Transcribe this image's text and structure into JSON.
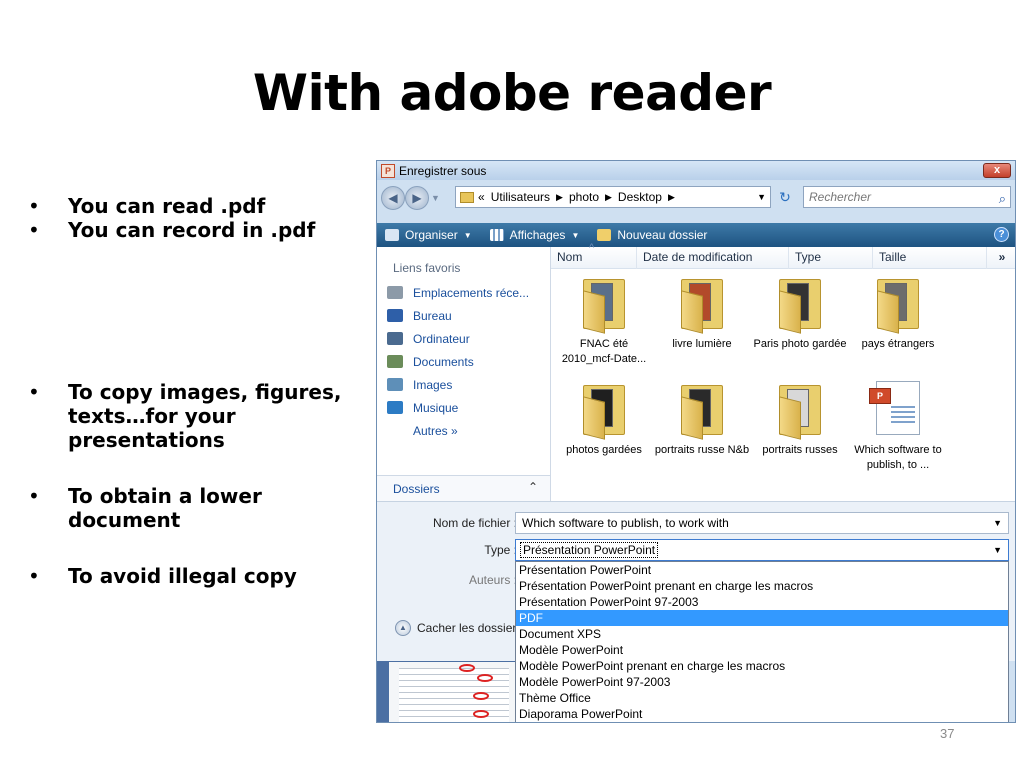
{
  "slide": {
    "title": "With adobe reader",
    "bullets": [
      "You can read .pdf",
      "You can record in .pdf",
      "To copy images, figures, texts…for your presentations",
      "To obtain a lower document",
      "To avoid illegal copy"
    ],
    "page_number": "37"
  },
  "dialog": {
    "title": "Enregistrer sous",
    "close_label": "x",
    "address": {
      "prefix": "«",
      "crumbs": [
        "Utilisateurs",
        "photo",
        "Desktop"
      ]
    },
    "search_placeholder": "Rechercher",
    "toolbar": {
      "organize": "Organiser",
      "views": "Affichages",
      "new_folder": "Nouveau dossier"
    },
    "favorites_heading": "Liens favoris",
    "favorites": [
      {
        "label": "Emplacements réce...",
        "icon": "recent-places-icon",
        "color": "#8c9aa8"
      },
      {
        "label": "Bureau",
        "icon": "desktop-icon",
        "color": "#2e5fa8"
      },
      {
        "label": "Ordinateur",
        "icon": "computer-icon",
        "color": "#4a6a8f"
      },
      {
        "label": "Documents",
        "icon": "documents-icon",
        "color": "#6b8c5a"
      },
      {
        "label": "Images",
        "icon": "images-icon",
        "color": "#5e8fb8"
      },
      {
        "label": "Musique",
        "icon": "music-icon",
        "color": "#2c7bc4"
      }
    ],
    "more_label": "Autres  »",
    "folders_label": "Dossiers",
    "columns": [
      "Nom",
      "Date de modification",
      "Type",
      "Taille",
      "»"
    ],
    "files": [
      {
        "name": "FNAC été 2010_mcf-Date...",
        "kind": "folder",
        "photo": "#5a6f8a"
      },
      {
        "name": "livre lumière",
        "kind": "folder",
        "photo": "#b24a2a"
      },
      {
        "name": "Paris photo gardée",
        "kind": "folder",
        "photo": "#333333"
      },
      {
        "name": "pays étrangers",
        "kind": "folder",
        "photo": "#6c6c6c"
      },
      {
        "name": "photos gardées",
        "kind": "folder",
        "photo": "#1f1f1f"
      },
      {
        "name": "portraits russe N&b",
        "kind": "folder",
        "photo": "#2a2a2a"
      },
      {
        "name": "portraits russes",
        "kind": "folder",
        "photo": "#d8d8d8"
      },
      {
        "name": "Which software to publish, to ...",
        "kind": "ppt",
        "photo": "#d04a2a"
      }
    ],
    "filename_label": "Nom de fichier :",
    "filename_value": "Which software to publish, to work with",
    "type_label": "Type :",
    "type_value": "Présentation PowerPoint",
    "authors_label": "Auteurs :",
    "hide_folders_label": "Cacher les dossier",
    "type_options": [
      "Présentation PowerPoint",
      "Présentation PowerPoint prenant en charge les macros",
      "Présentation PowerPoint 97-2003",
      "PDF",
      "Document XPS",
      "Modèle PowerPoint",
      "Modèle PowerPoint prenant en charge les macros",
      "Modèle PowerPoint 97-2003",
      "Thème Office",
      "Diaporama PowerPoint"
    ],
    "highlighted_option": "PDF"
  }
}
